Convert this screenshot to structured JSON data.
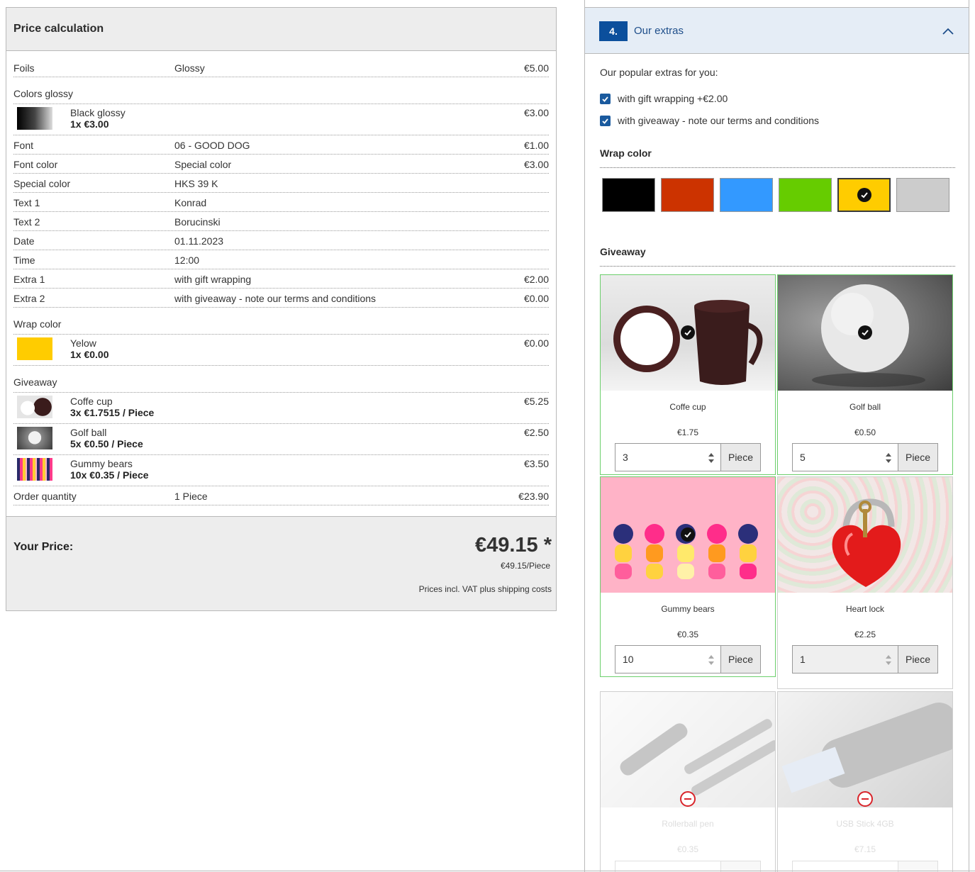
{
  "price_calc": {
    "title": "Price calculation",
    "rows": {
      "foils": {
        "label": "Foils",
        "value": "Glossy",
        "price": "€5.00"
      },
      "colors_glossy": {
        "label": "Colors glossy"
      },
      "black_glossy": {
        "name": "Black glossy",
        "qty": "1x €3.00",
        "price": "€3.00"
      },
      "font": {
        "label": "Font",
        "value": "06 - GOOD DOG",
        "price": "€1.00"
      },
      "font_color": {
        "label": "Font color",
        "value": "Special color",
        "price": "€3.00"
      },
      "special_color": {
        "label": "Special color",
        "value": "HKS 39 K",
        "price": ""
      },
      "text1": {
        "label": "Text 1",
        "value": "Konrad",
        "price": ""
      },
      "text2": {
        "label": "Text 2",
        "value": "Borucinski",
        "price": ""
      },
      "date": {
        "label": "Date",
        "value": "01.11.2023",
        "price": ""
      },
      "time": {
        "label": "Time",
        "value": "12:00",
        "price": ""
      },
      "extra1": {
        "label": "Extra 1",
        "value": "with gift wrapping",
        "price": "€2.00"
      },
      "extra2": {
        "label": "Extra 2",
        "value": "with giveaway - note our terms and conditions",
        "price": "€0.00"
      },
      "wrap_color": {
        "label": "Wrap color"
      },
      "yellow": {
        "name": "Yelow",
        "qty": "1x €0.00",
        "price": "€0.00"
      },
      "giveaway": {
        "label": "Giveaway"
      },
      "coffe_cup": {
        "name": "Coffe cup",
        "qty": "3x €1.7515 / Piece",
        "price": "€5.25"
      },
      "golf_ball": {
        "name": "Golf ball",
        "qty": "5x €0.50 / Piece",
        "price": "€2.50"
      },
      "gummy_bears": {
        "name": "Gummy bears",
        "qty": "10x €0.35 / Piece",
        "price": "€3.50"
      },
      "order_qty": {
        "label": "Order quantity",
        "value": "1 Piece",
        "price": "€23.90"
      }
    },
    "total": {
      "label": "Your Price:",
      "price": "€49.15 *",
      "per_piece": "€49.15/Piece",
      "vat_note": "Prices incl. VAT plus shipping costs"
    }
  },
  "extras": {
    "step": "4.",
    "title": "Our extras",
    "popular_label": "Our popular extras for you:",
    "options": [
      {
        "label": "with gift wrapping +€2.00",
        "checked": true
      },
      {
        "label": "with giveaway - note our terms and conditions",
        "checked": true
      }
    ],
    "wrap_color_heading": "Wrap color",
    "wrap_colors": [
      "#000000",
      "#cc3300",
      "#3399ff",
      "#66cc00",
      "#ffcc00",
      "#cccccc"
    ],
    "selected_wrap_color": "#ffcc00",
    "giveaway_heading": "Giveaway",
    "products": [
      {
        "name": "Coffe cup",
        "price": "€1.75",
        "qty": "3",
        "unit": "Piece",
        "selected": true
      },
      {
        "name": "Golf ball",
        "price": "€0.50",
        "qty": "5",
        "unit": "Piece",
        "selected": true
      },
      {
        "name": "Gummy bears",
        "price": "€0.35",
        "qty": "10",
        "unit": "Piece",
        "selected": true
      },
      {
        "name": "Heart lock",
        "price": "€2.25",
        "qty": "1",
        "unit": "Piece",
        "selected": false
      },
      {
        "name": "Rollerball pen",
        "price": "€0.35",
        "unavailable": true
      },
      {
        "name": "USB Stick 4GB",
        "price": "€7.15",
        "unavailable": true
      }
    ]
  }
}
